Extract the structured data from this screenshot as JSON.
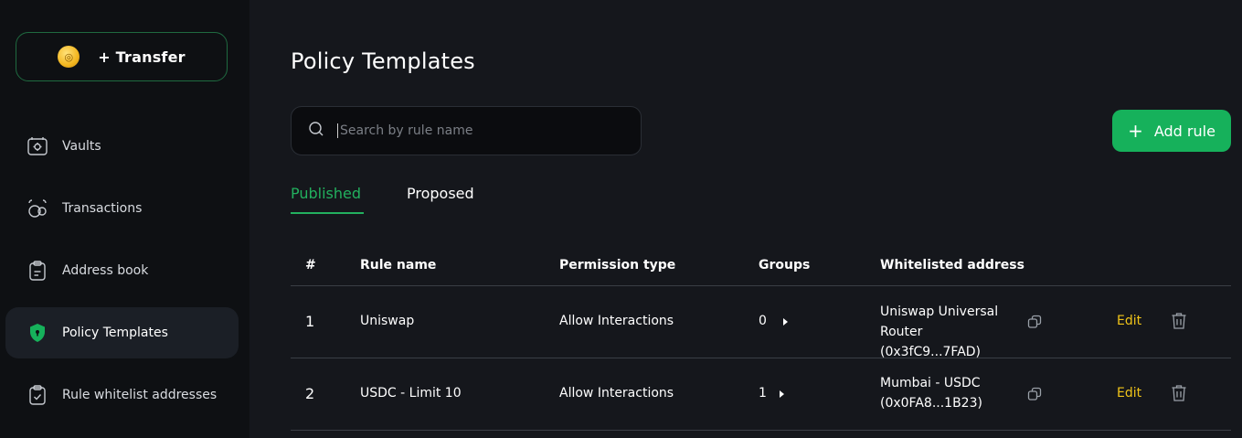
{
  "sidebar": {
    "transfer_label": "+ Transfer",
    "items": [
      {
        "label": "Vaults",
        "icon": "vault-icon"
      },
      {
        "label": "Transactions",
        "icon": "transactions-icon"
      },
      {
        "label": "Address book",
        "icon": "clipboard-icon"
      },
      {
        "label": "Policy Templates",
        "icon": "shield-icon",
        "active": true
      },
      {
        "label": "Rule whitelist addresses",
        "icon": "clipboard-check-icon"
      }
    ]
  },
  "page": {
    "title": "Policy Templates",
    "search_placeholder": "Search by rule name",
    "add_rule_label": "Add rule",
    "tabs": [
      {
        "label": "Published",
        "active": true
      },
      {
        "label": "Proposed",
        "active": false
      }
    ]
  },
  "table": {
    "headers": [
      "#",
      "Rule name",
      "Permission type",
      "Groups",
      "Whitelisted address"
    ],
    "rows": [
      {
        "num": "1",
        "rule_name": "Uniswap",
        "permission_type": "Allow Interactions",
        "groups": "0",
        "address": "Uniswap Universal Router (0x3fC9...7FAD)",
        "edit_label": "Edit"
      },
      {
        "num": "2",
        "rule_name": "USDC - Limit 10",
        "permission_type": "Allow Interactions",
        "groups": "1",
        "address": "Mumbai - USDC (0x0FA8...1B23)",
        "edit_label": "Edit"
      }
    ]
  },
  "colors": {
    "accent_green": "#16b15b",
    "edit_yellow": "#f0c419",
    "background": "#15171c",
    "sidebar_background": "#0e1013"
  }
}
